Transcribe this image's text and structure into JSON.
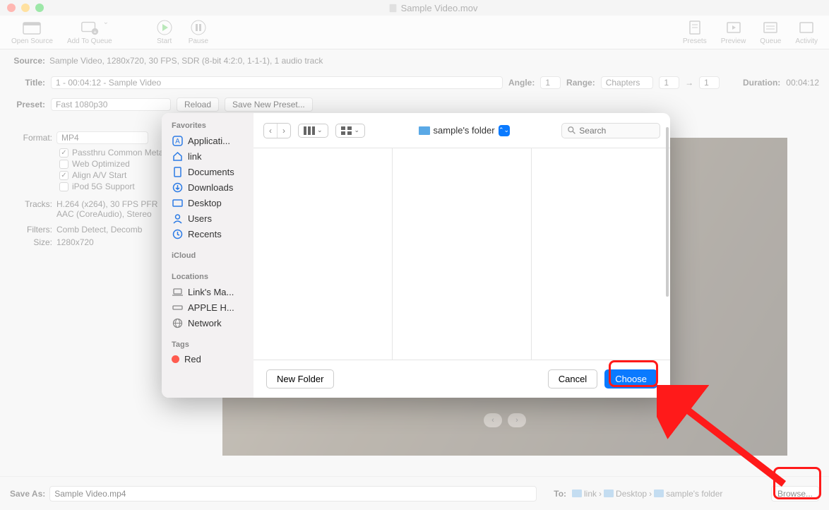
{
  "window": {
    "title": "Sample Video.mov"
  },
  "toolbar": {
    "open_source": "Open Source",
    "add_to_queue": "Add To Queue",
    "start": "Start",
    "pause": "Pause",
    "presets": "Presets",
    "preview": "Preview",
    "queue": "Queue",
    "activity": "Activity"
  },
  "source": {
    "label": "Source:",
    "value": "Sample Video, 1280x720, 30 FPS, SDR (8-bit 4:2:0, 1-1-1), 1 audio track"
  },
  "title_row": {
    "label": "Title:",
    "value": "1 - 00:04:12 - Sample Video"
  },
  "angle": {
    "label": "Angle:",
    "value": "1"
  },
  "range": {
    "label": "Range:",
    "type": "Chapters",
    "from": "1",
    "to": "1",
    "sep": "→"
  },
  "duration": {
    "label": "Duration:",
    "value": "00:04:12"
  },
  "preset": {
    "label": "Preset:",
    "value": "Fast 1080p30",
    "reload": "Reload",
    "save_new": "Save New Preset..."
  },
  "format": {
    "label": "Format:",
    "value": "MP4"
  },
  "checkboxes": {
    "passthru": "Passthru Common Metadata",
    "web_opt": "Web Optimized",
    "align": "Align A/V Start",
    "ipod": "iPod 5G Support"
  },
  "tracks": {
    "label": "Tracks:",
    "line1": "H.264 (x264), 30 FPS PFR",
    "line2": "AAC (CoreAudio), Stereo"
  },
  "filters": {
    "label": "Filters:",
    "value": "Comb Detect, Decomb"
  },
  "size": {
    "label": "Size:",
    "value": "1280x720"
  },
  "save": {
    "label": "Save As:",
    "value": "Sample Video.mp4"
  },
  "to": {
    "label": "To:",
    "crumbs": [
      "link",
      "Desktop",
      "sample's folder"
    ]
  },
  "browse": "Browse...",
  "dialog": {
    "sidebar": {
      "favorites_header": "Favorites",
      "favorites": [
        {
          "icon": "app",
          "label": "Applicati..."
        },
        {
          "icon": "home",
          "label": "link"
        },
        {
          "icon": "doc",
          "label": "Documents"
        },
        {
          "icon": "download",
          "label": "Downloads"
        },
        {
          "icon": "desktop",
          "label": "Desktop"
        },
        {
          "icon": "users",
          "label": "Users"
        },
        {
          "icon": "recent",
          "label": "Recents"
        }
      ],
      "icloud_header": "iCloud",
      "locations_header": "Locations",
      "locations": [
        {
          "icon": "laptop",
          "label": "Link's Ma..."
        },
        {
          "icon": "disk",
          "label": "APPLE H..."
        },
        {
          "icon": "network",
          "label": "Network"
        }
      ],
      "tags_header": "Tags",
      "tags": [
        {
          "color": "#ff5b4f",
          "label": "Red"
        }
      ]
    },
    "path": "sample's folder",
    "search_placeholder": "Search",
    "footer": {
      "new_folder": "New Folder",
      "cancel": "Cancel",
      "choose": "Choose"
    }
  }
}
